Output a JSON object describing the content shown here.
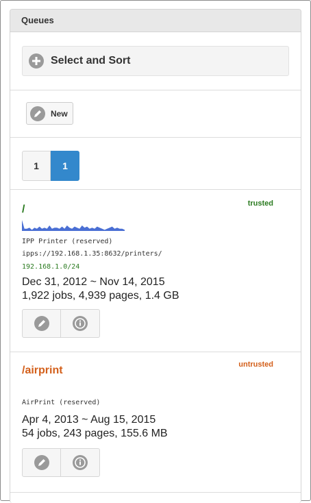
{
  "panel": {
    "title": "Queues"
  },
  "controls": {
    "select_sort_label": "Select and Sort",
    "new_label": "New"
  },
  "pagination": {
    "pages": [
      "1",
      "1"
    ],
    "active_index": 1
  },
  "colors": {
    "accent": "#3388cc",
    "trusted": "#2a7a1f",
    "untrusted": "#d35f1a",
    "icon_bg": "#9a9a9a"
  },
  "queues": [
    {
      "name": "/",
      "status": "trusted",
      "printer": "IPP Printer (reserved)",
      "uri": "ipps://192.168.1.35:8632/printers/",
      "network": "192.168.1.0/24",
      "date_range": "Dec 31, 2012 ~ Nov 14, 2015",
      "stats": "1,922 jobs, 4,939 pages, 1.4 GB",
      "sparkline": [
        10,
        2,
        2,
        3,
        1,
        3,
        2,
        4,
        2,
        3,
        2,
        5,
        2,
        3,
        3,
        2,
        4,
        2,
        5,
        3,
        2,
        4,
        3,
        2,
        5,
        3,
        4,
        2,
        3,
        2,
        4,
        3,
        2,
        1,
        2,
        3,
        4,
        2,
        3,
        2,
        2,
        1
      ]
    },
    {
      "name": "/airprint",
      "status": "untrusted",
      "printer": "AirPrint (reserved)",
      "date_range": "Apr 4, 2013 ~ Aug 15, 2015",
      "stats": "54 jobs, 243 pages, 155.6 MB"
    }
  ],
  "icons": [
    "plus-icon",
    "pencil-icon",
    "info-icon"
  ]
}
